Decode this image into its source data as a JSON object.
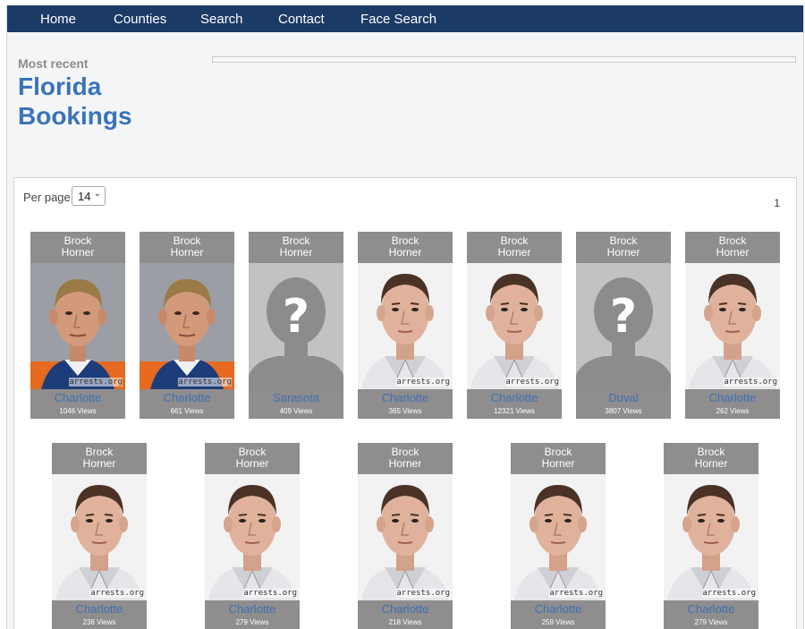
{
  "nav": {
    "items": [
      "Home",
      "Counties",
      "Search",
      "Contact",
      "Face Search"
    ],
    "bg_color": "#1b3a66"
  },
  "header": {
    "eyebrow": "Most recent",
    "title": "Florida Bookings"
  },
  "controls": {
    "per_page_label": "Per page",
    "per_page_value": "14",
    "current_page": "1"
  },
  "watermark": "arrests.org",
  "bookings": [
    {
      "first": "Brock",
      "last": "Horner",
      "county": "Charlotte",
      "views": "1046 Views",
      "photo": "mugshot-orange"
    },
    {
      "first": "Brock",
      "last": "Horner",
      "county": "Charlotte",
      "views": "661 Views",
      "photo": "mugshot-orange"
    },
    {
      "first": "Brock",
      "last": "Horner",
      "county": "Sarasota",
      "views": "409 Views",
      "photo": "placeholder"
    },
    {
      "first": "Brock",
      "last": "Horner",
      "county": "Charlotte",
      "views": "365 Views",
      "photo": "mugshot-white"
    },
    {
      "first": "Brock",
      "last": "Horner",
      "county": "Charlotte",
      "views": "12321 Views",
      "photo": "mugshot-white"
    },
    {
      "first": "Brock",
      "last": "Horner",
      "county": "Duval",
      "views": "3807 Views",
      "photo": "placeholder"
    },
    {
      "first": "Brock",
      "last": "Horner",
      "county": "Charlotte",
      "views": "262 Views",
      "photo": "mugshot-white"
    },
    {
      "first": "Brock",
      "last": "Horner",
      "county": "Charlotte",
      "views": "238 Views",
      "photo": "mugshot-white"
    },
    {
      "first": "Brock",
      "last": "Horner",
      "county": "Charlotte",
      "views": "279 Views",
      "photo": "mugshot-white"
    },
    {
      "first": "Brock",
      "last": "Horner",
      "county": "Charlotte",
      "views": "218 Views",
      "photo": "mugshot-white"
    },
    {
      "first": "Brock",
      "last": "Horner",
      "county": "Charlotte",
      "views": "259 Views",
      "photo": "mugshot-white"
    },
    {
      "first": "Brock",
      "last": "Horner",
      "county": "Charlotte",
      "views": "279 Views",
      "photo": "mugshot-white"
    }
  ]
}
